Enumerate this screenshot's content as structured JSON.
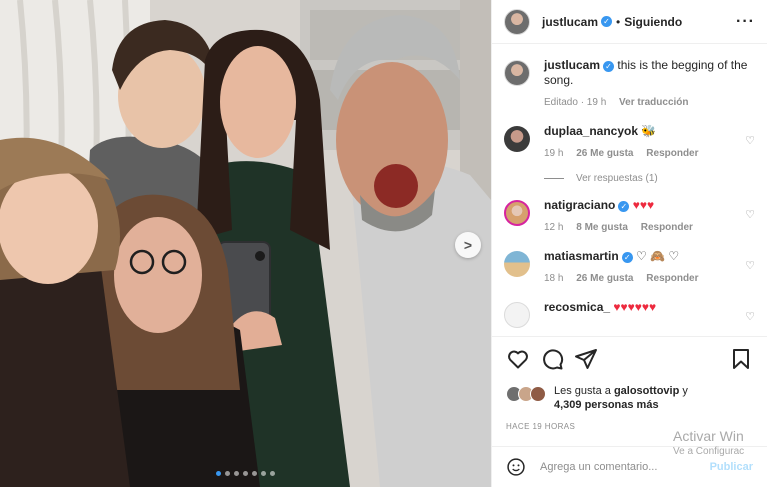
{
  "post": {
    "author": "justlucam",
    "follow_status": "Siguiendo",
    "separator": "•",
    "more_icon": "more-horizontal-icon",
    "caption": {
      "user": "justlucam",
      "text": "this is the begging of the song.",
      "edited": "Editado · 19 h",
      "translate": "Ver traducción"
    },
    "carousel": {
      "count": 7,
      "active_index": 0
    }
  },
  "comments": [
    {
      "user": "duplaa_nancyok",
      "text": "",
      "emoji": "🐝",
      "time": "19 h",
      "likes": "26 Me gusta",
      "reply": "Responder",
      "view_replies": "Ver respuestas (1)"
    },
    {
      "user": "natigraciano",
      "text": "",
      "emoji": "♥♥♥",
      "time": "12 h",
      "likes": "8 Me gusta",
      "reply": "Responder"
    },
    {
      "user": "matiasmartin",
      "text": "",
      "emoji": "♡ 🙈 ♡",
      "time": "18 h",
      "likes": "26 Me gusta",
      "reply": "Responder"
    },
    {
      "user": "recosmica_",
      "text": "",
      "emoji": "♥♥♥♥♥♥"
    }
  ],
  "likes": {
    "prefix": "Les gusta a",
    "user": "galosottovip",
    "and": "y",
    "others": "4,309 personas más"
  },
  "timestamp": "HACE 19 HORAS",
  "composer": {
    "placeholder": "Agrega un comentario...",
    "publish": "Publicar"
  },
  "watermark": {
    "line1": "Activar Win",
    "line2": "Ve a Configurac"
  },
  "colors": {
    "accent": "#3897f0",
    "heart": "#ed2a3e",
    "muted": "#8e8e8e"
  }
}
